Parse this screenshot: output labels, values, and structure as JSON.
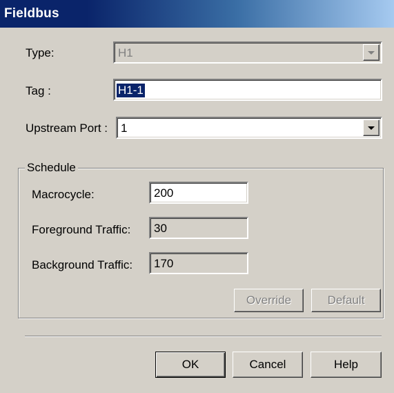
{
  "window": {
    "title": "Fieldbus"
  },
  "type": {
    "label": "Type:",
    "value": "H1"
  },
  "tag": {
    "label": "Tag :",
    "value": "H1-1"
  },
  "upstream_port": {
    "label": "Upstream Port :",
    "value": "1"
  },
  "schedule": {
    "title": "Schedule",
    "macrocycle": {
      "label": "Macrocycle:",
      "value": "200"
    },
    "foreground_traffic": {
      "label": "Foreground Traffic:",
      "value": "30"
    },
    "background_traffic": {
      "label": "Background Traffic:",
      "value": "170"
    },
    "override_label": "Override",
    "default_label": "Default"
  },
  "buttons": {
    "ok": "OK",
    "cancel": "Cancel",
    "help": "Help"
  },
  "colors": {
    "dialog_bg": "#d4d0c8",
    "title_bar": "#0a246a",
    "selection": "#0a246a"
  }
}
